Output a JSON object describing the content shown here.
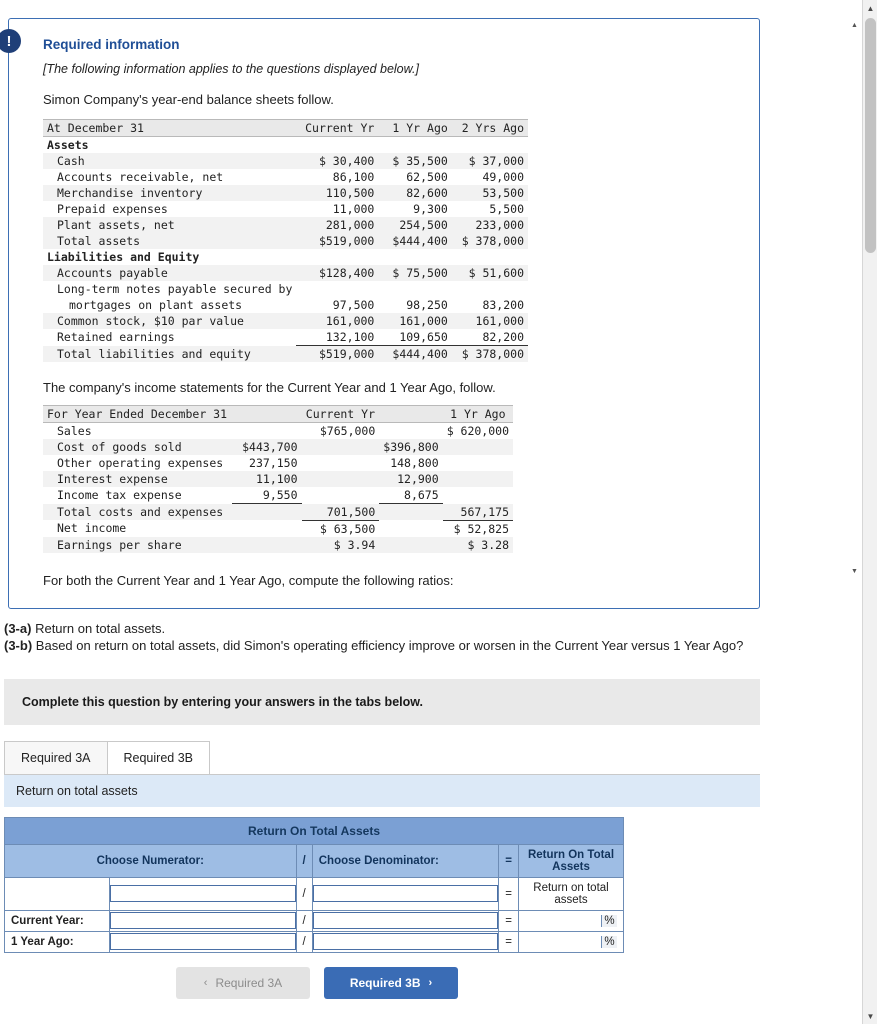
{
  "card": {
    "badge": "!",
    "required_info_title": "Required information",
    "required_info_sub": "[The following information applies to the questions displayed below.]",
    "intro_line": "Simon Company's year-end balance sheets follow.",
    "mid_line": "The company's income statements for the Current Year and 1 Year Ago, follow.",
    "final_line": "For both the Current Year and 1 Year Ago, compute the following ratios:"
  },
  "balance_sheet": {
    "header": [
      "At December 31",
      "Current Yr",
      "1 Yr Ago",
      "2 Yrs Ago"
    ],
    "rows": [
      {
        "label": "Assets",
        "indent": 0,
        "bold": true,
        "v1": "",
        "v2": "",
        "v3": ""
      },
      {
        "label": "Cash",
        "indent": 1,
        "bold": false,
        "v1": "$ 30,400",
        "v2": "$ 35,500",
        "v3": "$   37,000"
      },
      {
        "label": "Accounts receivable, net",
        "indent": 1,
        "bold": false,
        "v1": "86,100",
        "v2": "62,500",
        "v3": "49,000"
      },
      {
        "label": "Merchandise inventory",
        "indent": 1,
        "bold": false,
        "v1": "110,500",
        "v2": "82,600",
        "v3": "53,500"
      },
      {
        "label": "Prepaid expenses",
        "indent": 1,
        "bold": false,
        "v1": "11,000",
        "v2": "9,300",
        "v3": "5,500"
      },
      {
        "label": "Plant assets, net",
        "indent": 1,
        "bold": false,
        "v1": "281,000",
        "v2": "254,500",
        "v3": "233,000"
      },
      {
        "label": "Total assets",
        "indent": 1,
        "bold": false,
        "v1": "$519,000",
        "v2": "$444,400",
        "v3": "$ 378,000"
      },
      {
        "label": "Liabilities and Equity",
        "indent": 0,
        "bold": true,
        "v1": "",
        "v2": "",
        "v3": ""
      },
      {
        "label": "Accounts payable",
        "indent": 1,
        "bold": false,
        "v1": "$128,400",
        "v2": "$ 75,500",
        "v3": "$   51,600"
      },
      {
        "label": "Long-term notes payable secured by",
        "indent": 1,
        "bold": false,
        "v1": "",
        "v2": "",
        "v3": ""
      },
      {
        "label": "mortgages on plant assets",
        "indent": 2,
        "bold": false,
        "v1": "97,500",
        "v2": "98,250",
        "v3": "83,200"
      },
      {
        "label": "Common stock, $10 par value",
        "indent": 1,
        "bold": false,
        "v1": "161,000",
        "v2": "161,000",
        "v3": "161,000"
      },
      {
        "label": "Retained earnings",
        "indent": 1,
        "bold": false,
        "v1": "132,100",
        "v2": "109,650",
        "v3": "82,200"
      },
      {
        "label": "Total liabilities and equity",
        "indent": 1,
        "bold": false,
        "v1": "$519,000",
        "v2": "$444,400",
        "v3": "$ 378,000"
      }
    ]
  },
  "income_statement": {
    "header": [
      "For Year Ended December 31",
      "Current Yr",
      "1 Yr Ago"
    ],
    "rows": [
      {
        "label": "Sales",
        "a": "",
        "b": "$765,000",
        "c": "",
        "d": "$ 620,000"
      },
      {
        "label": "Cost of goods sold",
        "a": "$443,700",
        "b": "",
        "c": "$396,800",
        "d": ""
      },
      {
        "label": "Other operating expenses",
        "a": "237,150",
        "b": "",
        "c": "148,800",
        "d": ""
      },
      {
        "label": "Interest expense",
        "a": "11,100",
        "b": "",
        "c": "12,900",
        "d": ""
      },
      {
        "label": "Income tax expense",
        "a": "9,550",
        "b": "",
        "c": "8,675",
        "d": ""
      },
      {
        "label": "Total costs and expenses",
        "a": "",
        "b": "701,500",
        "c": "",
        "d": "567,175"
      },
      {
        "label": "Net income",
        "a": "",
        "b": "$ 63,500",
        "c": "",
        "d": "$  52,825"
      },
      {
        "label": "Earnings per share",
        "a": "",
        "b": "$    3.94",
        "c": "",
        "d": "$     3.28"
      }
    ]
  },
  "questions": {
    "q3a_label": "(3-a)",
    "q3a_text": "Return on total assets.",
    "q3b_label": "(3-b)",
    "q3b_text": "Based on return on total assets, did Simon's operating efficiency improve or worsen in the Current Year versus 1 Year Ago?"
  },
  "complete_banner": "Complete this question by entering your answers in the tabs below.",
  "tabs": [
    {
      "label": "Required 3A",
      "active": false
    },
    {
      "label": "Required 3B",
      "active": true
    }
  ],
  "subbar": "Return on total assets",
  "answer_table": {
    "title": "Return On Total Assets",
    "col_numerator": "Choose Numerator:",
    "col_slash": "/",
    "col_denominator": "Choose Denominator:",
    "col_equals": "=",
    "col_result": "Return On Total Assets",
    "result_label": "Return on total assets",
    "rows": [
      {
        "label": "Current Year:",
        "numerator": "",
        "denominator": "",
        "result": "",
        "pct": "%"
      },
      {
        "label": "1 Year Ago:",
        "numerator": "",
        "denominator": "",
        "result": "",
        "pct": "%"
      }
    ]
  },
  "nav": {
    "prev_label": "Required 3A",
    "prev_chevron": "‹",
    "next_label": "Required 3B",
    "next_chevron": "›"
  },
  "scrollbar": {
    "up_arrow": "▲",
    "down_arrow": "▼"
  }
}
